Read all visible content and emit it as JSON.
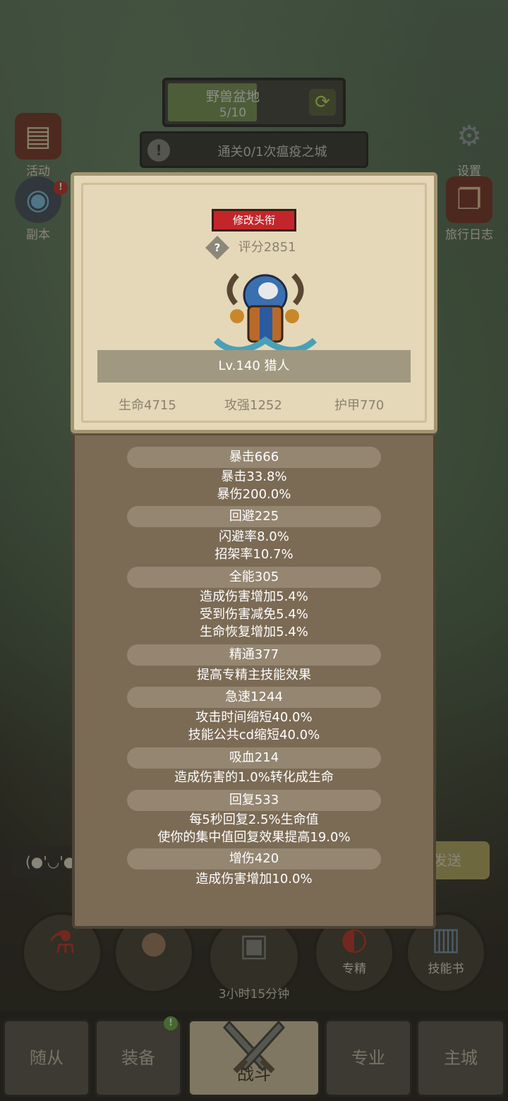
{
  "zone": {
    "name": "野兽盆地",
    "progress": "5/10",
    "progress_fraction": 0.5,
    "switch_icon": "refresh-icon"
  },
  "quest": {
    "text": "通关0/1次瘟疫之城"
  },
  "left_menu": [
    {
      "label": "活动",
      "icon": "event-board-icon"
    },
    {
      "label": "副本",
      "icon": "dungeon-icon",
      "badge": "!"
    }
  ],
  "right_menu": [
    {
      "label": "设置",
      "icon": "gear-icon"
    },
    {
      "label": "旅行日志",
      "icon": "journal-icon"
    }
  ],
  "bottom": {
    "timer": "3小时15分钟",
    "specialize_label": "专精",
    "skillbook_label": "技能书",
    "send_label": "发送",
    "emote_text": "(●'◡'●"
  },
  "tabs": [
    {
      "label": "随从"
    },
    {
      "label": "装备",
      "badge": "!"
    },
    {
      "label": "战斗"
    },
    {
      "label": "专业"
    },
    {
      "label": "主城"
    }
  ],
  "character": {
    "change_title_button": "修改头衔",
    "score_help": "?",
    "score": "评分2851",
    "name_line": "Lv.140 猎人",
    "stats": {
      "hp": "生命4715",
      "atk": "攻强1252",
      "armor": "护甲770"
    }
  },
  "attributes": [
    {
      "header": "暴击666",
      "lines": [
        "暴击33.8%",
        "暴伤200.0%"
      ]
    },
    {
      "header": "回避225",
      "lines": [
        "闪避率8.0%",
        "招架率10.7%"
      ]
    },
    {
      "header": "全能305",
      "lines": [
        "造成伤害增加5.4%",
        "受到伤害减免5.4%",
        "生命恢复增加5.4%"
      ]
    },
    {
      "header": "精通377",
      "lines": [
        "提高专精主技能效果"
      ]
    },
    {
      "header": "急速1244",
      "lines": [
        "攻击时间缩短40.0%",
        "技能公共cd缩短40.0%"
      ]
    },
    {
      "header": "吸血214",
      "lines": [
        "造成伤害的1.0%转化成生命"
      ]
    },
    {
      "header": "回复533",
      "lines": [
        "每5秒回复2.5%生命值",
        "使你的集中值回复效果提高19.0%"
      ]
    },
    {
      "header": "增伤420",
      "lines": [
        "造成伤害增加10.0%"
      ]
    }
  ],
  "colors": {
    "accent_red": "#c2262a",
    "parchment": "#e4d8b8",
    "panel_brown": "#7b6b55"
  }
}
